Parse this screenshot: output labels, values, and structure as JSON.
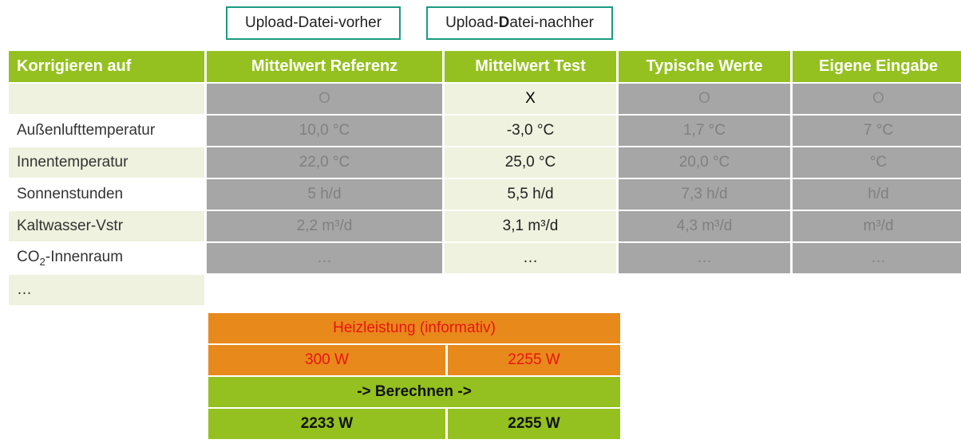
{
  "upload": {
    "vorher": "Upload-Datei-vorher",
    "nachher_pre": "Upload-",
    "nachher_bold": "D",
    "nachher_post": "atei-nachher"
  },
  "headers": {
    "c1": "Korrigieren auf",
    "c2": "Mittelwert Referenz",
    "c3": "Mittelwert Test",
    "c4": "Typische Werte",
    "c5": "Eigene Eingabe"
  },
  "selector": {
    "ref": "O",
    "test": "X",
    "typ": "O",
    "eig": "O"
  },
  "rows": [
    {
      "label": "Außenlufttemperatur",
      "ref": "10,0 °C",
      "test": "-3,0 °C",
      "typ": "1,7 °C",
      "eig": "7  °C"
    },
    {
      "label": "Innentemperatur",
      "ref": "22,0 °C",
      "test": "25,0 °C",
      "typ": "20,0 °C",
      "eig": "°C"
    },
    {
      "label": "Sonnenstunden",
      "ref": "5 h/d",
      "test": "5,5 h/d",
      "typ": "7,3 h/d",
      "eig": "h/d"
    },
    {
      "label": "Kaltwasser-Vstr",
      "ref": "2,2 m³/d",
      "test": "3,1 m³/d",
      "typ": "4,3 m³/d",
      "eig": "m³/d"
    },
    {
      "label_html": "CO<sub>2</sub>-Innenraum",
      "ref": "…",
      "test": "…",
      "typ": "…",
      "eig": "…"
    },
    {
      "label": "…",
      "ref": "",
      "test": "",
      "typ": "",
      "eig": "",
      "blank": true
    }
  ],
  "bottom": {
    "heiz_label": "Heizleistung (informativ)",
    "heiz_ref": "300 W",
    "heiz_test": "2255 W",
    "berechnen": "-> Berechnen ->",
    "result_ref": "2233 W",
    "result_test": "2255 W"
  },
  "chart_data": {
    "type": "table",
    "title": "Korrigieren auf",
    "columns": [
      "Mittelwert Referenz",
      "Mittelwert Test",
      "Typische Werte",
      "Eigene Eingabe"
    ],
    "selected_column": "Mittelwert Test",
    "rows": [
      {
        "Korrigieren auf": "Außenlufttemperatur",
        "Mittelwert Referenz": 10.0,
        "Mittelwert Test": -3.0,
        "Typische Werte": 1.7,
        "Eigene Eingabe": 7,
        "unit": "°C"
      },
      {
        "Korrigieren auf": "Innentemperatur",
        "Mittelwert Referenz": 22.0,
        "Mittelwert Test": 25.0,
        "Typische Werte": 20.0,
        "Eigene Eingabe": null,
        "unit": "°C"
      },
      {
        "Korrigieren auf": "Sonnenstunden",
        "Mittelwert Referenz": 5,
        "Mittelwert Test": 5.5,
        "Typische Werte": 7.3,
        "Eigene Eingabe": null,
        "unit": "h/d"
      },
      {
        "Korrigieren auf": "Kaltwasser-Vstr",
        "Mittelwert Referenz": 2.2,
        "Mittelwert Test": 3.1,
        "Typische Werte": 4.3,
        "Eigene Eingabe": null,
        "unit": "m³/d"
      },
      {
        "Korrigieren auf": "CO2-Innenraum",
        "Mittelwert Referenz": null,
        "Mittelwert Test": null,
        "Typische Werte": null,
        "Eigene Eingabe": null,
        "unit": ""
      }
    ],
    "heizleistung_informativ": {
      "Mittelwert Referenz": 300,
      "Mittelwert Test": 2255,
      "unit": "W"
    },
    "berechnet": {
      "Mittelwert Referenz": 2233,
      "Mittelwert Test": 2255,
      "unit": "W"
    }
  }
}
